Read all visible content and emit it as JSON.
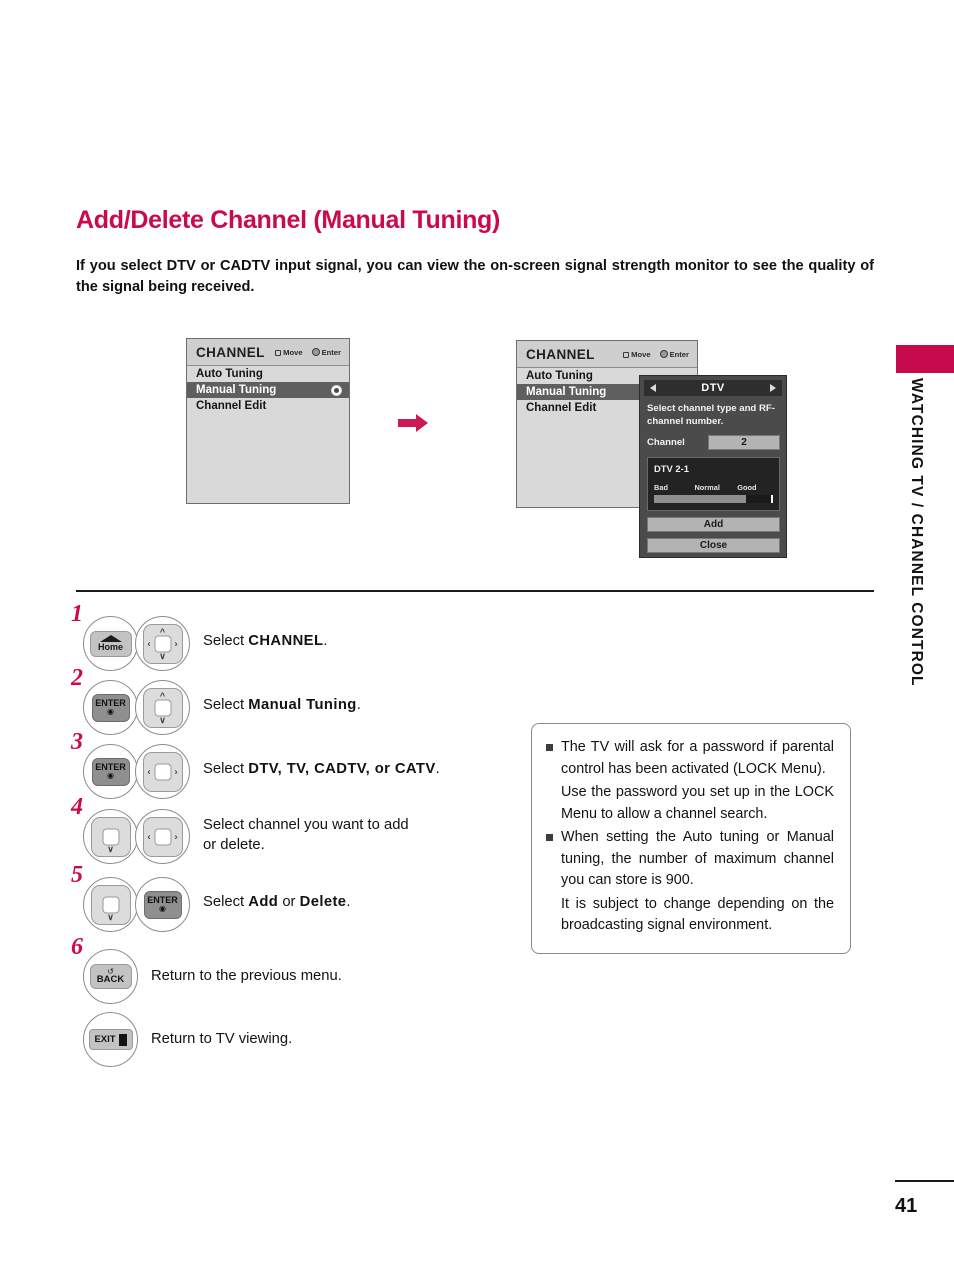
{
  "page": {
    "title": "Add/Delete Channel (Manual Tuning)",
    "intro": "If you select DTV or CADTV input signal, you can view the on-screen signal strength monitor to see the quality of the signal being received.",
    "number": "41",
    "sidebar_label": "WATCHING TV / CHANNEL CONTROL",
    "accent_color": "#cc0a4b",
    "sidebar_tab_color": "#c70a4c"
  },
  "osd_left": {
    "header_title": "CHANNEL",
    "hint_move": "Move",
    "hint_enter": "Enter",
    "items": [
      {
        "label": "Auto Tuning",
        "selected": false,
        "radio": false
      },
      {
        "label": "Manual Tuning",
        "selected": true,
        "radio": true
      },
      {
        "label": "Channel Edit",
        "selected": false,
        "radio": false
      }
    ]
  },
  "osd_right": {
    "header_title": "CHANNEL",
    "hint_move": "Move",
    "hint_enter": "Enter",
    "items": [
      {
        "label": "Auto Tuning",
        "selected": false
      },
      {
        "label": "Manual Tuning",
        "selected": true
      },
      {
        "label": "Channel Edit",
        "selected": false
      }
    ]
  },
  "dtv_dialog": {
    "title": "DTV",
    "description": "Select channel type and\nRF-channel number.",
    "channel_label": "Channel",
    "channel_value": "2",
    "signal": {
      "channel": "DTV 2-1",
      "scale_bad": "Bad",
      "scale_normal": "Normal",
      "scale_good": "Good",
      "level_percent": 79
    },
    "add_button": "Add",
    "close_button": "Close"
  },
  "steps": [
    {
      "num": "1",
      "keys": [
        "home",
        "pad-ud-lr"
      ],
      "text_prefix": "Select ",
      "text_bold": "CHANNEL",
      "text_suffix": "."
    },
    {
      "num": "2",
      "keys": [
        "enter",
        "pad-ud"
      ],
      "text_prefix": "Select ",
      "text_bold": "Manual Tuning",
      "text_suffix": "."
    },
    {
      "num": "3",
      "keys": [
        "enter",
        "pad-lr"
      ],
      "text_prefix": "Select ",
      "text_bold": "DTV, TV, CADTV, or CATV",
      "text_suffix": "."
    },
    {
      "num": "4",
      "keys": [
        "pad-d",
        "pad-lr"
      ],
      "text_prefix": "Select channel you want to add\nor delete.",
      "text_bold": "",
      "text_suffix": ""
    },
    {
      "num": "5",
      "keys": [
        "pad-d",
        "enter"
      ],
      "text_prefix": "Select ",
      "text_bold": "Add",
      "text_mid": " or ",
      "text_bold2": "Delete",
      "text_suffix": "."
    },
    {
      "num": "6",
      "keys": [
        "back"
      ],
      "text_prefix": "Return to the previous menu.",
      "text_bold": "",
      "text_suffix": ""
    },
    {
      "num": "",
      "keys": [
        "exit"
      ],
      "text_prefix": "Return to TV viewing.",
      "text_bold": "",
      "text_suffix": ""
    }
  ],
  "key_labels": {
    "home": "Home",
    "enter": "ENTER",
    "back": "BACK",
    "exit": "EXIT"
  },
  "notes": [
    {
      "bullet": true,
      "text": "The TV will ask for a password if parental control has been activated (LOCK Menu)."
    },
    {
      "bullet": false,
      "text": "Use the password you set up in the LOCK Menu to allow a channel search."
    },
    {
      "bullet": true,
      "text": "When setting the Auto tuning or Manual tuning, the number of maximum channel you can store is 900."
    },
    {
      "bullet": false,
      "text": "It is subject to change depending on the broadcasting signal environment."
    }
  ]
}
